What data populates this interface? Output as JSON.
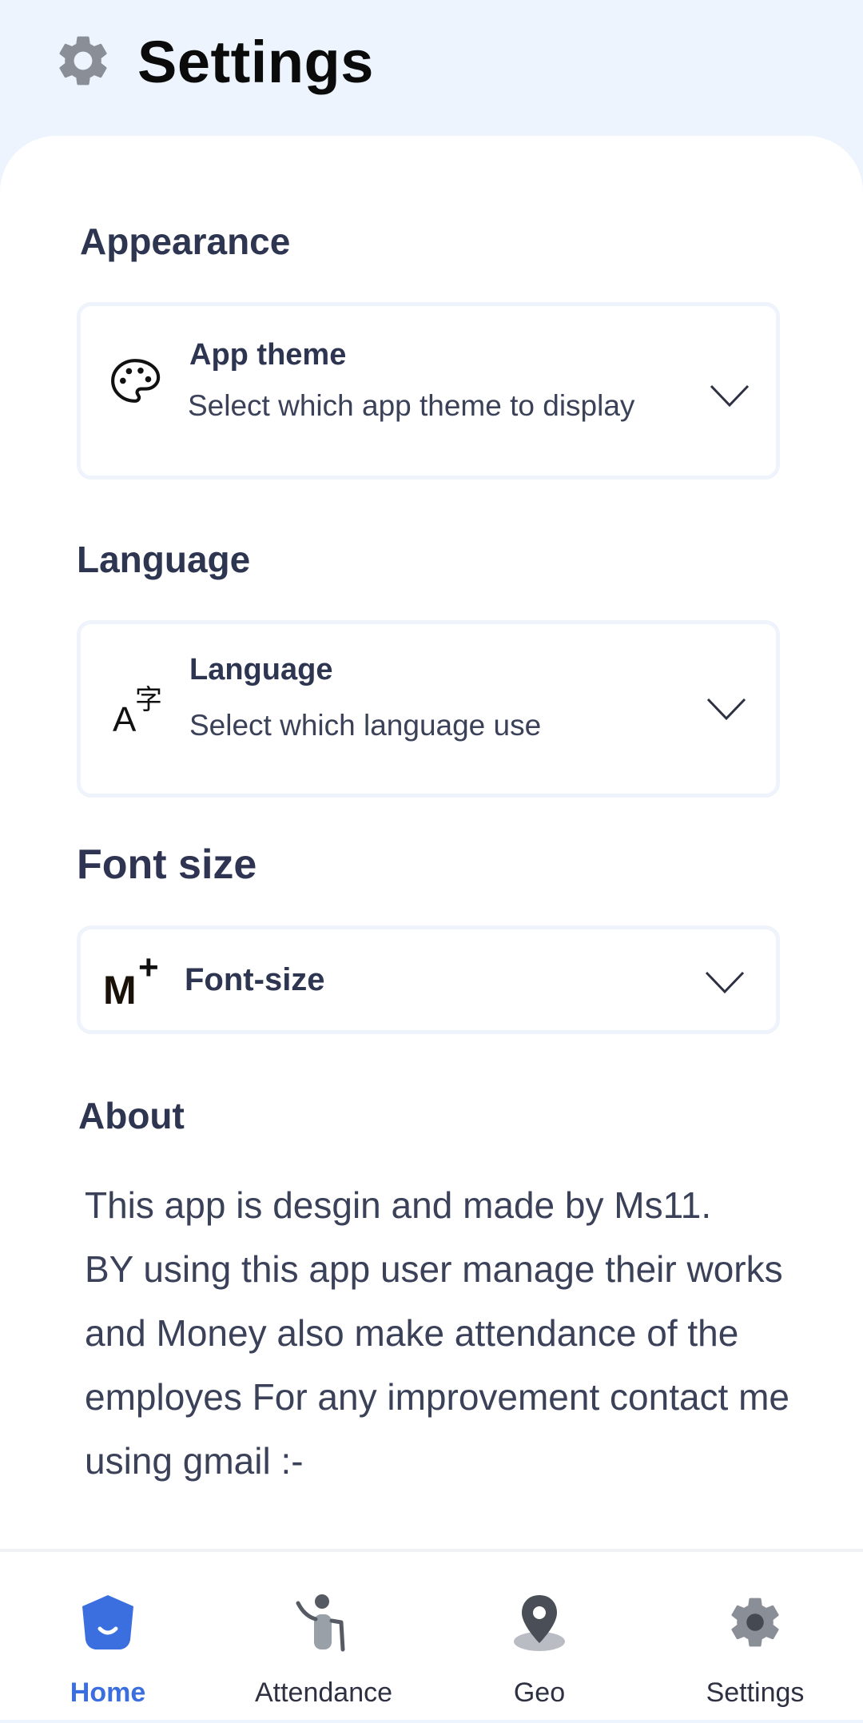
{
  "header": {
    "title": "Settings",
    "icon": "gear-icon"
  },
  "sections": {
    "appearance": {
      "title": "Appearance",
      "card": {
        "icon": "palette-icon",
        "label": "App theme",
        "description": "Select which app theme to display",
        "chevron": "chevron-down-icon"
      }
    },
    "language": {
      "title": "Language",
      "card": {
        "icon": "translate-icon",
        "label": "Language",
        "description": "Select which language use",
        "chevron": "chevron-down-icon"
      }
    },
    "font_size": {
      "title": "Font size",
      "card": {
        "icon": "font-size-icon",
        "icon_text": "M",
        "icon_plus": "+",
        "label": "Font-size",
        "chevron": "chevron-down-icon"
      }
    },
    "about": {
      "title": "About",
      "lines": [
        "This app is desgin and made by Ms11.",
        "BY using this app user manage their works",
        "and Money also make attendance of the",
        "employes For any improvement contact me",
        "using gmail :-"
      ]
    }
  },
  "bottom_nav": {
    "active": "Home",
    "items": [
      {
        "label": "Home",
        "icon": "home-icon"
      },
      {
        "label": "Attendance",
        "icon": "attendance-icon"
      },
      {
        "label": "Geo",
        "icon": "location-pin-icon"
      },
      {
        "label": "Settings",
        "icon": "gear-icon"
      }
    ]
  },
  "colors": {
    "accent": "#3b6fe0",
    "header_bg": "#eef4fe",
    "text_dark": "#2d3550",
    "icon_gray": "#8a8e97"
  }
}
